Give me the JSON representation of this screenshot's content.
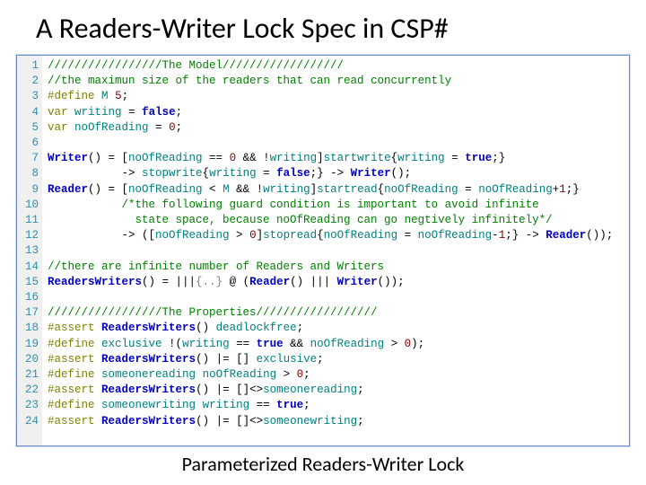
{
  "title": "A Readers-Writer Lock Spec in CSP#",
  "caption": "Parameterized Readers-Writer Lock",
  "gutter": "1\n2\n3\n4\n5\n6\n7\n8\n9\n10\n11\n12\n13\n14\n15\n16\n17\n18\n19\n20\n21\n22\n23\n24",
  "code": {
    "l1": "/////////////////The Model//////////////////",
    "l2": "//the maximun size of the readers that can read concurrently",
    "l3_a": "#define",
    "l3_b": "M",
    "l3_c": "5",
    "l3_d": ";",
    "l4_a": "var",
    "l4_b": "writing",
    "l4_c": " = ",
    "l4_d": "false",
    "l4_e": ";",
    "l5_a": "var",
    "l5_b": "noOfReading",
    "l5_c": " = ",
    "l5_d": "0",
    "l5_e": ";",
    "l7_a": "Writer",
    "l7_b": "() = [",
    "l7_c": "noOfReading",
    "l7_d": " == ",
    "l7_e": "0",
    "l7_f": " && !",
    "l7_g": "writing",
    "l7_h": "]",
    "l7_i": "startwrite",
    "l7_j": "{",
    "l7_k": "writing",
    "l7_l": " = ",
    "l7_m": "true",
    "l7_n": ";}",
    "l8_a": "           -> ",
    "l8_b": "stopwrite",
    "l8_c": "{",
    "l8_d": "writing",
    "l8_e": " = ",
    "l8_f": "false",
    "l8_g": ";} -> ",
    "l8_h": "Writer",
    "l8_i": "();",
    "l9_a": "Reader",
    "l9_b": "() = [",
    "l9_c": "noOfReading",
    "l9_d": " < ",
    "l9_e": "M",
    "l9_f": " && !",
    "l9_g": "writing",
    "l9_h": "]",
    "l9_i": "startread",
    "l9_j": "{",
    "l9_k": "noOfReading",
    "l9_l": " = ",
    "l9_m": "noOfReading",
    "l9_n": "+",
    "l9_o": "1",
    "l9_p": ";}",
    "l10": "           /*the following guard condition is important to avoid infinite",
    "l11": "             state space, because noOfReading can go negtively infinitely*/",
    "l12_a": "           -> ([",
    "l12_b": "noOfReading",
    "l12_c": " > ",
    "l12_d": "0",
    "l12_e": "]",
    "l12_f": "stopread",
    "l12_g": "{",
    "l12_h": "noOfReading",
    "l12_i": " = ",
    "l12_j": "noOfReading",
    "l12_k": "-",
    "l12_l": "1",
    "l12_m": ";} -> ",
    "l12_n": "Reader",
    "l12_o": "());",
    "l14": "//there are infinite number of Readers and Writers",
    "l15_a": "ReadersWriters",
    "l15_b": "() = |||",
    "l15_c": "{..}",
    "l15_d": " @ (",
    "l15_e": "Reader",
    "l15_f": "() ||| ",
    "l15_g": "Writer",
    "l15_h": "());",
    "l17": "/////////////////The Properties//////////////////",
    "l18_a": "#assert",
    "l18_b": "ReadersWriters",
    "l18_c": "() ",
    "l18_d": "deadlockfree",
    "l18_e": ";",
    "l19_a": "#define",
    "l19_b": "exclusive",
    "l19_c": " !(",
    "l19_d": "writing",
    "l19_e": " == ",
    "l19_f": "true",
    "l19_g": " && ",
    "l19_h": "noOfReading",
    "l19_i": " > ",
    "l19_j": "0",
    "l19_k": ");",
    "l20_a": "#assert",
    "l20_b": "ReadersWriters",
    "l20_c": "() |= [] ",
    "l20_d": "exclusive",
    "l20_e": ";",
    "l21_a": "#define",
    "l21_b": "someonereading",
    "l21_c": "noOfReading",
    "l21_d": " > ",
    "l21_e": "0",
    "l21_f": ";",
    "l22_a": "#assert",
    "l22_b": "ReadersWriters",
    "l22_c": "() |= []<>",
    "l22_d": "someonereading",
    "l22_e": ";",
    "l23_a": "#define",
    "l23_b": "someonewriting",
    "l23_c": "writing",
    "l23_d": " == ",
    "l23_e": "true",
    "l23_f": ";",
    "l24_a": "#assert",
    "l24_b": "ReadersWriters",
    "l24_c": "() |= []<>",
    "l24_d": "someonewriting",
    "l24_e": ";"
  }
}
